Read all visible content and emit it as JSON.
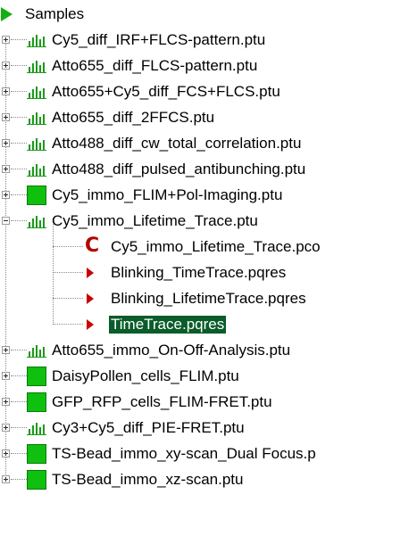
{
  "tree": {
    "root_label": "Samples",
    "files": [
      {
        "label": "Cy5_diff_IRF+FLCS-pattern.ptu",
        "icon": "bar-chart-icon",
        "expanded": false
      },
      {
        "label": "Atto655_diff_FLCS-pattern.ptu",
        "icon": "bar-chart-icon",
        "expanded": false
      },
      {
        "label": "Atto655+Cy5_diff_FCS+FLCS.ptu",
        "icon": "bar-chart-icon",
        "expanded": false
      },
      {
        "label": "Atto655_diff_2FFCS.ptu",
        "icon": "bar-chart-icon",
        "expanded": false
      },
      {
        "label": "Atto488_diff_cw_total_correlation.ptu",
        "icon": "bar-chart-icon",
        "expanded": false
      },
      {
        "label": "Atto488_diff_pulsed_antibunching.ptu",
        "icon": "bar-chart-icon",
        "expanded": false
      },
      {
        "label": "Cy5_immo_FLIM+Pol-Imaging.ptu",
        "icon": "image-square-icon",
        "expanded": false
      },
      {
        "label": "Cy5_immo_Lifetime_Trace.ptu",
        "icon": "bar-chart-icon",
        "expanded": true,
        "children": [
          {
            "label": "Cy5_immo_Lifetime_Trace.pco",
            "icon": "pco-c-icon",
            "selected": false
          },
          {
            "label": "Blinking_TimeTrace.pqres",
            "icon": "result-arrow-icon",
            "selected": false
          },
          {
            "label": "Blinking_LifetimeTrace.pqres",
            "icon": "result-arrow-icon",
            "selected": false
          },
          {
            "label": "TimeTrace.pqres",
            "icon": "result-arrow-icon",
            "selected": true
          }
        ]
      },
      {
        "label": "Atto655_immo_On-Off-Analysis.ptu",
        "icon": "bar-chart-icon",
        "expanded": false
      },
      {
        "label": "DaisyPollen_cells_FLIM.ptu",
        "icon": "image-square-icon",
        "expanded": false
      },
      {
        "label": "GFP_RFP_cells_FLIM-FRET.ptu",
        "icon": "image-square-icon",
        "expanded": false
      },
      {
        "label": "Cy3+Cy5_diff_PIE-FRET.ptu",
        "icon": "bar-chart-icon",
        "expanded": false
      },
      {
        "label": "TS-Bead_immo_xy-scan_Dual Focus.p",
        "icon": "image-square-icon",
        "expanded": false
      },
      {
        "label": "TS-Bead_immo_xz-scan.ptu",
        "icon": "image-square-icon",
        "expanded": false
      }
    ]
  },
  "colors": {
    "selection_bg": "#0a5c2a",
    "chart_icon": "#1a9a1a",
    "image_icon": "#0fc00f",
    "result_icon": "#c80000"
  }
}
